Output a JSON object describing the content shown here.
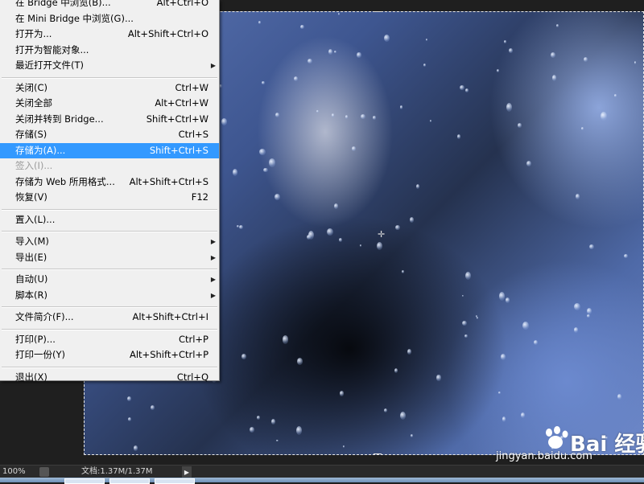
{
  "menu": {
    "items": [
      {
        "label": "在 Bridge 中浏览(B)...",
        "shortcut": "Alt+Ctrl+O",
        "state": "normal"
      },
      {
        "label": "在 Mini Bridge 中浏览(G)...",
        "shortcut": "",
        "state": "normal"
      },
      {
        "label": "打开为...",
        "shortcut": "Alt+Shift+Ctrl+O",
        "state": "normal"
      },
      {
        "label": "打开为智能对象...",
        "shortcut": "",
        "state": "normal"
      },
      {
        "label": "最近打开文件(T)",
        "shortcut": "",
        "state": "submenu"
      },
      {
        "label": "关闭(C)",
        "shortcut": "Ctrl+W",
        "state": "normal"
      },
      {
        "label": "关闭全部",
        "shortcut": "Alt+Ctrl+W",
        "state": "normal"
      },
      {
        "label": "关闭并转到 Bridge...",
        "shortcut": "Shift+Ctrl+W",
        "state": "normal"
      },
      {
        "label": "存储(S)",
        "shortcut": "Ctrl+S",
        "state": "normal"
      },
      {
        "label": "存储为(A)...",
        "shortcut": "Shift+Ctrl+S",
        "state": "highlight"
      },
      {
        "label": "签入(I)...",
        "shortcut": "",
        "state": "disabled"
      },
      {
        "label": "存储为 Web 所用格式...",
        "shortcut": "Alt+Shift+Ctrl+S",
        "state": "normal"
      },
      {
        "label": "恢复(V)",
        "shortcut": "F12",
        "state": "normal"
      },
      {
        "label": "置入(L)...",
        "shortcut": "",
        "state": "normal"
      },
      {
        "label": "导入(M)",
        "shortcut": "",
        "state": "submenu"
      },
      {
        "label": "导出(E)",
        "shortcut": "",
        "state": "submenu"
      },
      {
        "label": "自动(U)",
        "shortcut": "",
        "state": "submenu"
      },
      {
        "label": "脚本(R)",
        "shortcut": "",
        "state": "submenu"
      },
      {
        "label": "文件简介(F)...",
        "shortcut": "Alt+Shift+Ctrl+I",
        "state": "normal"
      },
      {
        "label": "打印(P)...",
        "shortcut": "Ctrl+P",
        "state": "normal"
      },
      {
        "label": "打印一份(Y)",
        "shortcut": "Alt+Shift+Ctrl+P",
        "state": "normal"
      },
      {
        "label": "退出(X)",
        "shortcut": "Ctrl+Q",
        "state": "normal"
      }
    ],
    "submenu_arrow": "▶"
  },
  "status_bar": {
    "zoom": "100%",
    "doc_info": "文档:1.37M/1.37M",
    "arrow": "▶"
  },
  "watermark": {
    "brand": "Bai 经验",
    "url": "jingyan.baidu.com"
  },
  "colors": {
    "menu_bg": "#f0f0f0",
    "highlight": "#3399ff",
    "workspace": "#1f1f1f"
  }
}
